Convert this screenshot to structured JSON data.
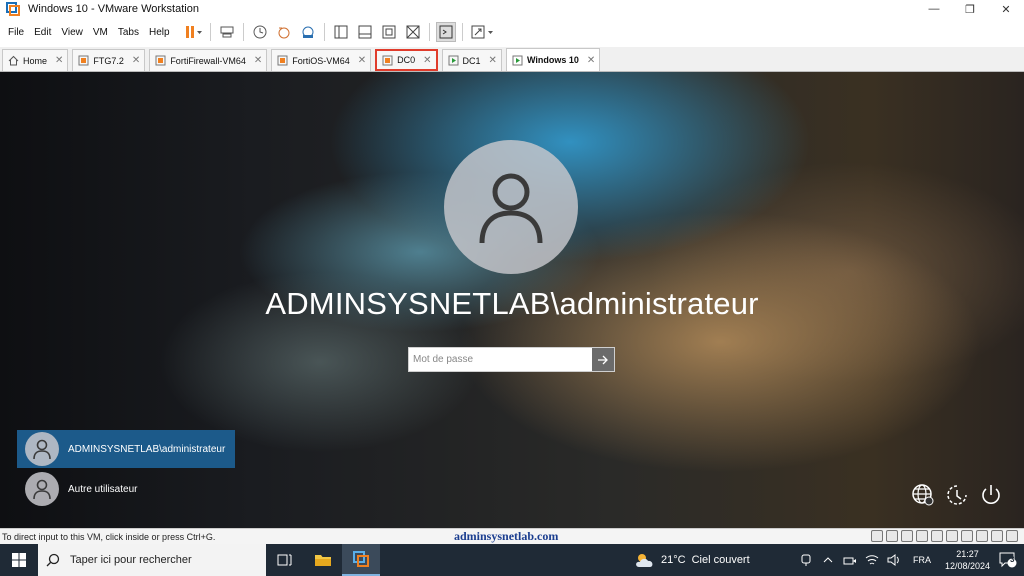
{
  "window": {
    "title": "Windows 10  - VMware Workstation"
  },
  "menu": [
    "File",
    "Edit",
    "View",
    "VM",
    "Tabs",
    "Help"
  ],
  "tabs": [
    {
      "label": "Home",
      "active": false,
      "highlight": false,
      "icon": "home-icon"
    },
    {
      "label": "FTG7.2",
      "active": false,
      "highlight": false,
      "icon": "vm-icon"
    },
    {
      "label": "FortiFirewall-VM64",
      "active": false,
      "highlight": false,
      "icon": "vm-icon"
    },
    {
      "label": "FortiOS-VM64",
      "active": false,
      "highlight": false,
      "icon": "vm-icon"
    },
    {
      "label": "DC0",
      "active": false,
      "highlight": true,
      "icon": "vm-icon"
    },
    {
      "label": "DC1",
      "active": false,
      "highlight": false,
      "icon": "vm-running-icon"
    },
    {
      "label": "Windows 10",
      "active": true,
      "highlight": false,
      "icon": "vm-running-icon"
    }
  ],
  "login": {
    "username": "ADMINSYSNETLAB\\administrateur",
    "password_placeholder": "Mot de passe",
    "users": [
      {
        "label": "ADMINSYSNETLAB\\administrateur",
        "selected": true
      },
      {
        "label": "Autre utilisateur",
        "selected": false
      }
    ]
  },
  "statusbar": {
    "hint": "To direct input to this VM, click inside or press Ctrl+G.",
    "watermark": "adminsysnetlab.com"
  },
  "taskbar": {
    "search_placeholder": "Taper ici pour rechercher",
    "weather_temp": "21°C",
    "weather_text": "Ciel couvert",
    "language": "FRA",
    "time": "21:27",
    "date": "12/08/2024",
    "notification_count": "3"
  },
  "colors": {
    "accent": "#1c5a8a",
    "tab_highlight": "#e03c2c",
    "vmware_pause": "#f08020",
    "taskbar": "#1f2a36"
  }
}
